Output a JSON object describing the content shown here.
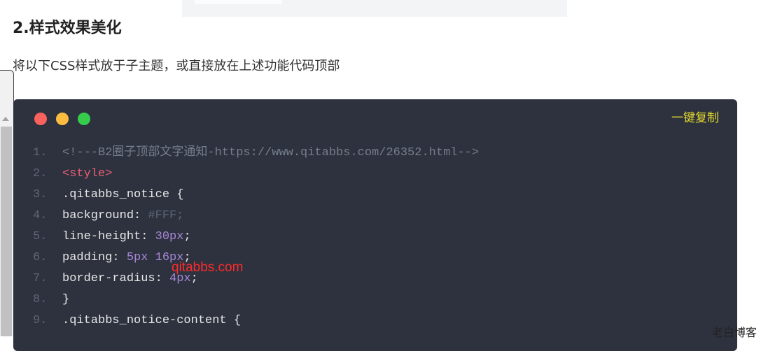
{
  "heading": "2.样式效果美化",
  "intro": "将以下CSS样式放于子主题，或直接放在上述功能代码顶部",
  "code_block": {
    "copy_label": "一键复制",
    "colors": {
      "background": "#2d323e",
      "close": "#fc625d",
      "minimize": "#fdbc40",
      "maximize": "#35cd4b",
      "copy": "#e6db2c"
    },
    "lines": [
      {
        "num": "1.",
        "parts": [
          {
            "text": "<!---B2圈子顶部文字通知-https://www.qitabbs.com/26352.html-->",
            "kind": "comment"
          }
        ]
      },
      {
        "num": "2.",
        "parts": [
          {
            "text": "<style>",
            "kind": "tag"
          }
        ]
      },
      {
        "num": "3.",
        "parts": [
          {
            "text": ".qitabbs_notice {",
            "kind": "plain"
          }
        ]
      },
      {
        "num": "4.",
        "parts": [
          {
            "text": "background: ",
            "kind": "plain"
          },
          {
            "text": "#FFF;",
            "kind": "faded"
          }
        ]
      },
      {
        "num": "5.",
        "parts": [
          {
            "text": "line-height: ",
            "kind": "plain"
          },
          {
            "text": "30px",
            "kind": "num"
          },
          {
            "text": ";",
            "kind": "plain"
          }
        ]
      },
      {
        "num": "6.",
        "parts": [
          {
            "text": "padding: ",
            "kind": "plain"
          },
          {
            "text": "5px 16px",
            "kind": "num"
          },
          {
            "text": ";",
            "kind": "plain"
          }
        ]
      },
      {
        "num": "7.",
        "parts": [
          {
            "text": "border-radius: ",
            "kind": "plain"
          },
          {
            "text": "4px",
            "kind": "num"
          },
          {
            "text": ";",
            "kind": "plain"
          }
        ]
      },
      {
        "num": "8.",
        "parts": [
          {
            "text": "}",
            "kind": "plain"
          }
        ]
      },
      {
        "num": "9.",
        "parts": [
          {
            "text": ".qitabbs_notice-content {",
            "kind": "plain"
          }
        ]
      }
    ]
  },
  "watermark": "qitabbs.com",
  "corner_label": "老白博客"
}
